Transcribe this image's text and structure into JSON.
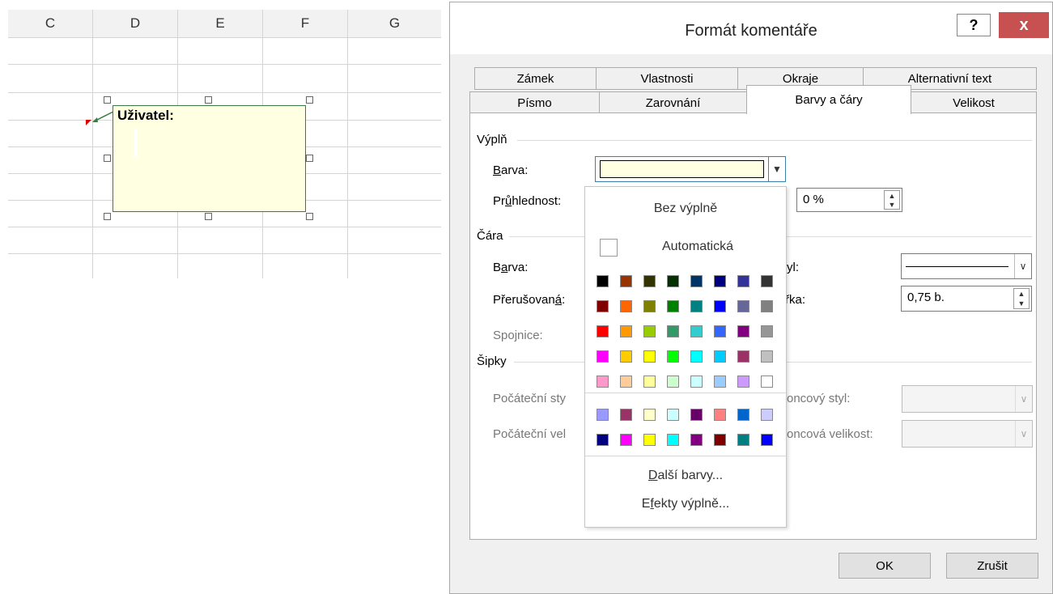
{
  "sheet": {
    "columns": [
      "C",
      "D",
      "E",
      "F",
      "G"
    ],
    "comment_author": "Uživatel:"
  },
  "dialog": {
    "title": "Formát komentáře",
    "help": "?",
    "close": "x",
    "tabs_row1": [
      "Zámek",
      "Vlastnosti",
      "Okraje",
      "Alternativní text"
    ],
    "tabs_row2": [
      "Písmo",
      "Zarovnání",
      "Barvy a čáry",
      "Velikost"
    ],
    "active_tab": "Barvy a čáry",
    "fill": {
      "section": "Výplň",
      "color_label_key": "B",
      "color_label_rest": "arva:",
      "color_value": "#ffffe1",
      "transparency_label_pre": "Pr",
      "transparency_label_key": "ů",
      "transparency_label_rest": "hlednost:",
      "transparency_value": "0 %"
    },
    "line": {
      "section": "Čára",
      "color_label_pre": "B",
      "color_label_key": "a",
      "color_label_rest": "rva:",
      "dashed_label_pre": "Přerušovan",
      "dashed_label_key": "á",
      "dashed_label_rest": ":",
      "connector_label": "Spojnice:",
      "style_label": "yl:",
      "width_label": "řka:",
      "width_value": "0,75 b."
    },
    "arrows": {
      "section": "Šipky",
      "start_style": "Počáteční sty",
      "start_size": "Počáteční vel",
      "end_style": "oncový styl:",
      "end_size": "oncová velikost:"
    },
    "ok": "OK",
    "cancel": "Zrušit"
  },
  "color_dropdown": {
    "no_fill": "Bez výplně",
    "automatic": "Automatická",
    "more_colors_key": "D",
    "more_colors_rest": "alší barvy...",
    "fill_effects_pre": "E",
    "fill_effects_key": "f",
    "fill_effects_rest": "ekty výplně...",
    "palette": [
      [
        "#000000",
        "#993300",
        "#333300",
        "#003300",
        "#003366",
        "#000080",
        "#333399",
        "#333333"
      ],
      [
        "#800000",
        "#ff6600",
        "#808000",
        "#008000",
        "#008080",
        "#0000ff",
        "#666699",
        "#808080"
      ],
      [
        "#ff0000",
        "#ff9900",
        "#99cc00",
        "#339966",
        "#33cccc",
        "#3366ff",
        "#800080",
        "#969696"
      ],
      [
        "#ff00ff",
        "#ffcc00",
        "#ffff00",
        "#00ff00",
        "#00ffff",
        "#00ccff",
        "#993366",
        "#c0c0c0"
      ],
      [
        "#ff99cc",
        "#ffcc99",
        "#ffff99",
        "#ccffcc",
        "#ccffff",
        "#99ccff",
        "#cc99ff",
        "#ffffff"
      ]
    ],
    "palette_extra": [
      [
        "#9999ff",
        "#993366",
        "#ffffcc",
        "#ccffff",
        "#660066",
        "#ff8080",
        "#0066cc",
        "#ccccff"
      ],
      [
        "#000080",
        "#ff00ff",
        "#ffff00",
        "#00ffff",
        "#800080",
        "#800000",
        "#008080",
        "#0000ff"
      ]
    ]
  }
}
